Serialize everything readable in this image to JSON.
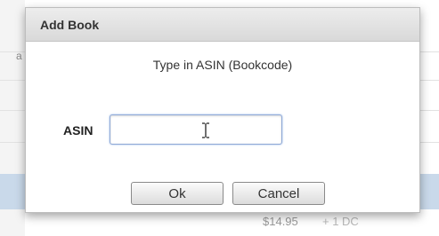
{
  "dialog": {
    "title": "Add Book",
    "prompt": "Type in ASIN (Bookcode)",
    "field_label": "ASIN",
    "field_value": "",
    "ok_label": "Ok",
    "cancel_label": "Cancel"
  },
  "background": {
    "row_mark": "a",
    "price": "$14.95",
    "trailing_text": "+ 1 DC"
  },
  "colors": {
    "dialog_title_bg": "#e3e3e3",
    "selected_row_bg": "#c9d9ea",
    "field_focus_border": "#8fa9d6"
  },
  "icons": {
    "text_cursor": "i-beam-cursor-icon"
  }
}
